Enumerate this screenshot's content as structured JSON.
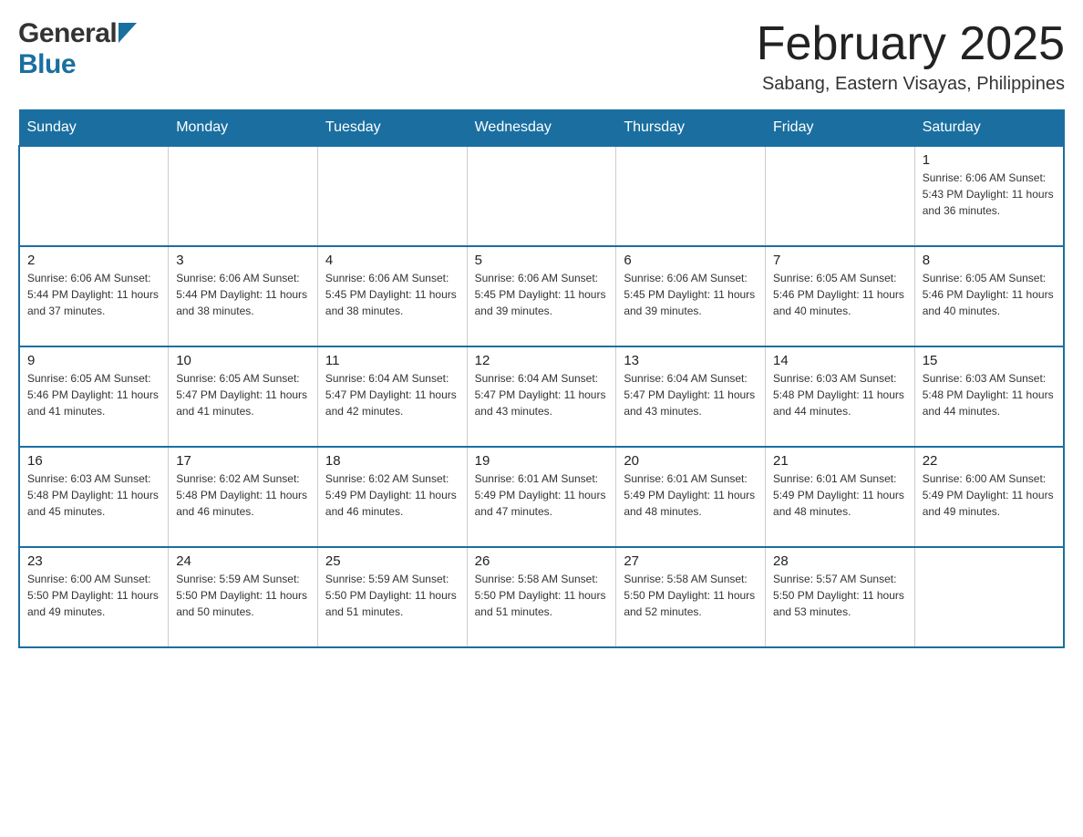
{
  "header": {
    "logo_general": "General",
    "logo_blue": "Blue",
    "month_title": "February 2025",
    "location": "Sabang, Eastern Visayas, Philippines"
  },
  "days_of_week": [
    "Sunday",
    "Monday",
    "Tuesday",
    "Wednesday",
    "Thursday",
    "Friday",
    "Saturday"
  ],
  "weeks": [
    {
      "cells": [
        {
          "day": "",
          "info": "",
          "empty": true
        },
        {
          "day": "",
          "info": "",
          "empty": true
        },
        {
          "day": "",
          "info": "",
          "empty": true
        },
        {
          "day": "",
          "info": "",
          "empty": true
        },
        {
          "day": "",
          "info": "",
          "empty": true
        },
        {
          "day": "",
          "info": "",
          "empty": true
        },
        {
          "day": "1",
          "info": "Sunrise: 6:06 AM\nSunset: 5:43 PM\nDaylight: 11 hours and 36 minutes.",
          "empty": false
        }
      ]
    },
    {
      "cells": [
        {
          "day": "2",
          "info": "Sunrise: 6:06 AM\nSunset: 5:44 PM\nDaylight: 11 hours and 37 minutes.",
          "empty": false
        },
        {
          "day": "3",
          "info": "Sunrise: 6:06 AM\nSunset: 5:44 PM\nDaylight: 11 hours and 38 minutes.",
          "empty": false
        },
        {
          "day": "4",
          "info": "Sunrise: 6:06 AM\nSunset: 5:45 PM\nDaylight: 11 hours and 38 minutes.",
          "empty": false
        },
        {
          "day": "5",
          "info": "Sunrise: 6:06 AM\nSunset: 5:45 PM\nDaylight: 11 hours and 39 minutes.",
          "empty": false
        },
        {
          "day": "6",
          "info": "Sunrise: 6:06 AM\nSunset: 5:45 PM\nDaylight: 11 hours and 39 minutes.",
          "empty": false
        },
        {
          "day": "7",
          "info": "Sunrise: 6:05 AM\nSunset: 5:46 PM\nDaylight: 11 hours and 40 minutes.",
          "empty": false
        },
        {
          "day": "8",
          "info": "Sunrise: 6:05 AM\nSunset: 5:46 PM\nDaylight: 11 hours and 40 minutes.",
          "empty": false
        }
      ]
    },
    {
      "cells": [
        {
          "day": "9",
          "info": "Sunrise: 6:05 AM\nSunset: 5:46 PM\nDaylight: 11 hours and 41 minutes.",
          "empty": false
        },
        {
          "day": "10",
          "info": "Sunrise: 6:05 AM\nSunset: 5:47 PM\nDaylight: 11 hours and 41 minutes.",
          "empty": false
        },
        {
          "day": "11",
          "info": "Sunrise: 6:04 AM\nSunset: 5:47 PM\nDaylight: 11 hours and 42 minutes.",
          "empty": false
        },
        {
          "day": "12",
          "info": "Sunrise: 6:04 AM\nSunset: 5:47 PM\nDaylight: 11 hours and 43 minutes.",
          "empty": false
        },
        {
          "day": "13",
          "info": "Sunrise: 6:04 AM\nSunset: 5:47 PM\nDaylight: 11 hours and 43 minutes.",
          "empty": false
        },
        {
          "day": "14",
          "info": "Sunrise: 6:03 AM\nSunset: 5:48 PM\nDaylight: 11 hours and 44 minutes.",
          "empty": false
        },
        {
          "day": "15",
          "info": "Sunrise: 6:03 AM\nSunset: 5:48 PM\nDaylight: 11 hours and 44 minutes.",
          "empty": false
        }
      ]
    },
    {
      "cells": [
        {
          "day": "16",
          "info": "Sunrise: 6:03 AM\nSunset: 5:48 PM\nDaylight: 11 hours and 45 minutes.",
          "empty": false
        },
        {
          "day": "17",
          "info": "Sunrise: 6:02 AM\nSunset: 5:48 PM\nDaylight: 11 hours and 46 minutes.",
          "empty": false
        },
        {
          "day": "18",
          "info": "Sunrise: 6:02 AM\nSunset: 5:49 PM\nDaylight: 11 hours and 46 minutes.",
          "empty": false
        },
        {
          "day": "19",
          "info": "Sunrise: 6:01 AM\nSunset: 5:49 PM\nDaylight: 11 hours and 47 minutes.",
          "empty": false
        },
        {
          "day": "20",
          "info": "Sunrise: 6:01 AM\nSunset: 5:49 PM\nDaylight: 11 hours and 48 minutes.",
          "empty": false
        },
        {
          "day": "21",
          "info": "Sunrise: 6:01 AM\nSunset: 5:49 PM\nDaylight: 11 hours and 48 minutes.",
          "empty": false
        },
        {
          "day": "22",
          "info": "Sunrise: 6:00 AM\nSunset: 5:49 PM\nDaylight: 11 hours and 49 minutes.",
          "empty": false
        }
      ]
    },
    {
      "cells": [
        {
          "day": "23",
          "info": "Sunrise: 6:00 AM\nSunset: 5:50 PM\nDaylight: 11 hours and 49 minutes.",
          "empty": false
        },
        {
          "day": "24",
          "info": "Sunrise: 5:59 AM\nSunset: 5:50 PM\nDaylight: 11 hours and 50 minutes.",
          "empty": false
        },
        {
          "day": "25",
          "info": "Sunrise: 5:59 AM\nSunset: 5:50 PM\nDaylight: 11 hours and 51 minutes.",
          "empty": false
        },
        {
          "day": "26",
          "info": "Sunrise: 5:58 AM\nSunset: 5:50 PM\nDaylight: 11 hours and 51 minutes.",
          "empty": false
        },
        {
          "day": "27",
          "info": "Sunrise: 5:58 AM\nSunset: 5:50 PM\nDaylight: 11 hours and 52 minutes.",
          "empty": false
        },
        {
          "day": "28",
          "info": "Sunrise: 5:57 AM\nSunset: 5:50 PM\nDaylight: 11 hours and 53 minutes.",
          "empty": false
        },
        {
          "day": "",
          "info": "",
          "empty": true
        }
      ]
    }
  ]
}
